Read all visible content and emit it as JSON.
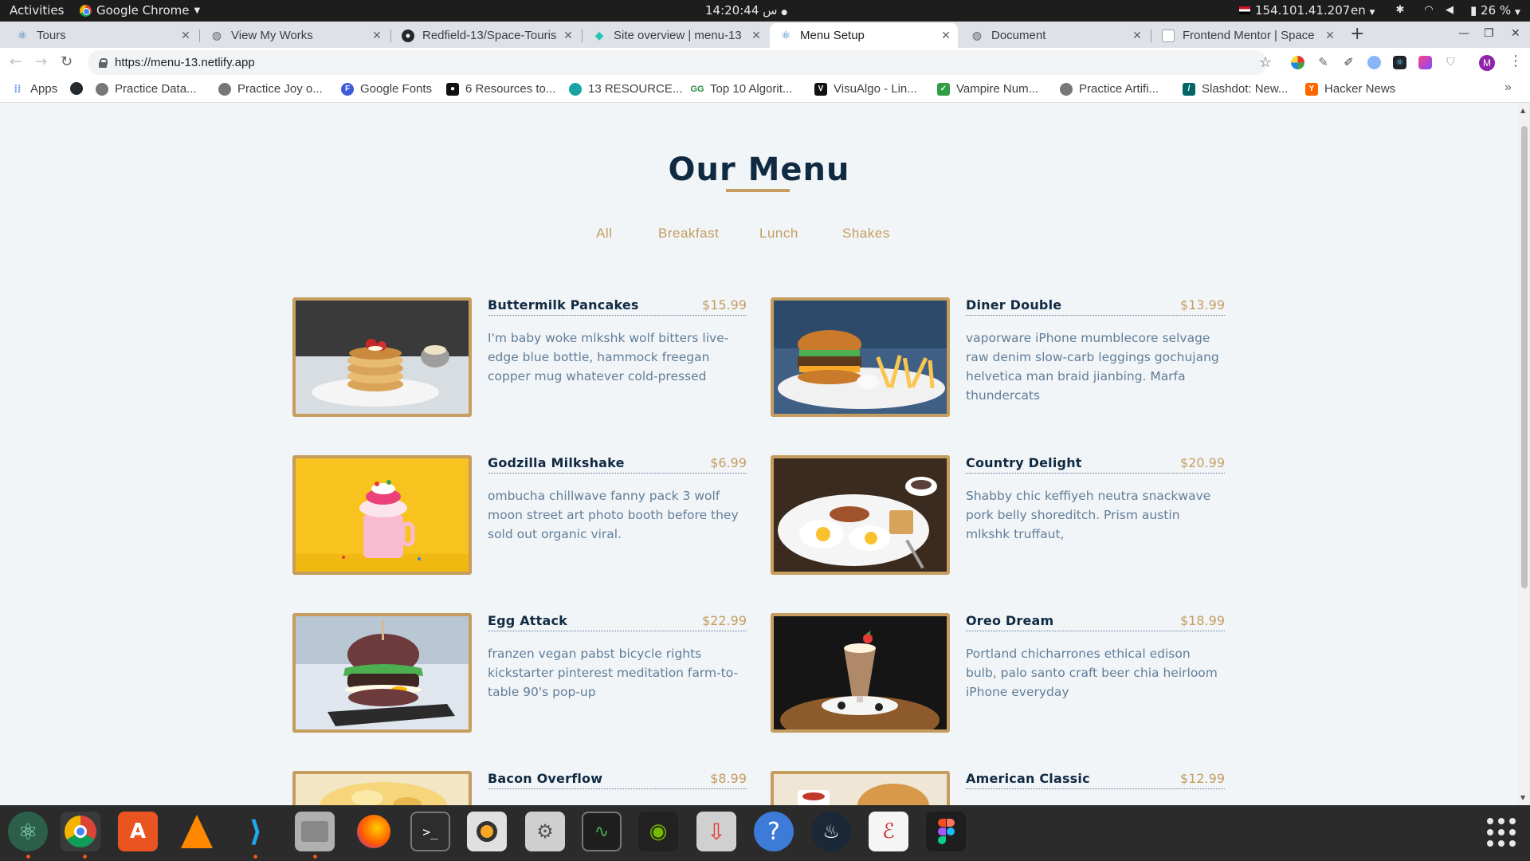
{
  "topbar": {
    "activities": "Activities",
    "app_name": "Google Chrome",
    "clock": "14:20:44 س",
    "ip": "154.101.41.207",
    "lang": "en",
    "battery": "26 %"
  },
  "tabs": [
    {
      "label": "Tours",
      "favicon_color": "#2a7ab0"
    },
    {
      "label": "View My Works",
      "favicon_color": "#5f6368"
    },
    {
      "label": "Redfield-13/Space-Touris",
      "favicon_color": "#24292e"
    },
    {
      "label": "Site overview | menu-13",
      "favicon_color": "#20c6b7"
    },
    {
      "label": "Menu Setup",
      "favicon_color": "#2a7ab0"
    },
    {
      "label": "Document",
      "favicon_color": "#5f6368"
    },
    {
      "label": "Frontend Mentor | Space",
      "favicon_color": "#9aa0a6"
    }
  ],
  "toolbar": {
    "url": "https://menu-13.netlify.app"
  },
  "bookmarks": [
    {
      "label": "Apps",
      "icon": "apps-grid-icon",
      "color": "#4285f4"
    },
    {
      "label": "",
      "icon": "github-icon",
      "color": "#24292e"
    },
    {
      "label": "Practice Data...",
      "icon": "globe-icon",
      "color": "#777777"
    },
    {
      "label": "Practice Joy o...",
      "icon": "globe-icon",
      "color": "#777777"
    },
    {
      "label": "Google Fonts",
      "icon": "fonts-icon",
      "color": "#3b5bdb"
    },
    {
      "label": "6 Resources to...",
      "icon": "medium-icon",
      "color": "#111111"
    },
    {
      "label": "13 RESOURCE...",
      "icon": "globe-icon",
      "color": "#1aa3a3"
    },
    {
      "label": "Top 10 Algorit...",
      "icon": "gfg-icon",
      "color": "#2f8d46"
    },
    {
      "label": "VisuAlgo - Lin...",
      "icon": "visualgo-icon",
      "color": "#111111"
    },
    {
      "label": "Vampire Num...",
      "icon": "bookmark-icon",
      "color": "#2f9e44"
    },
    {
      "label": "Practice Artifi...",
      "icon": "globe-icon",
      "color": "#777777"
    },
    {
      "label": "Slashdot: New...",
      "icon": "slashdot-icon",
      "color": "#006666"
    },
    {
      "label": "Hacker News",
      "icon": "ycombinator-icon",
      "color": "#ff6600"
    }
  ],
  "page": {
    "title": "Our Menu",
    "filters": [
      "All",
      "Breakfast",
      "Lunch",
      "Shakes"
    ],
    "items": [
      {
        "name": "Buttermilk Pancakes",
        "price": "$15.99",
        "desc": "I'm baby woke mlkshk wolf bitters live-edge blue bottle, hammock freegan copper mug whatever cold-pressed"
      },
      {
        "name": "Diner Double",
        "price": "$13.99",
        "desc": "vaporware iPhone mumblecore selvage raw denim slow-carb leggings gochujang helvetica man braid jianbing. Marfa thundercats"
      },
      {
        "name": "Godzilla Milkshake",
        "price": "$6.99",
        "desc": "ombucha chillwave fanny pack 3 wolf moon street art photo booth before they sold out organic viral."
      },
      {
        "name": "Country Delight",
        "price": "$20.99",
        "desc": "Shabby chic keffiyeh neutra snackwave pork belly shoreditch. Prism austin mlkshk truffaut,"
      },
      {
        "name": "Egg Attack",
        "price": "$22.99",
        "desc": "franzen vegan pabst bicycle rights kickstarter pinterest meditation farm-to-table 90's pop-up"
      },
      {
        "name": "Oreo Dream",
        "price": "$18.99",
        "desc": "Portland chicharrones ethical edison bulb, palo santo craft beer chia heirloom iPhone everyday"
      },
      {
        "name": "Bacon Overflow",
        "price": "$8.99",
        "desc": ""
      },
      {
        "name": "American Classic",
        "price": "$12.99",
        "desc": ""
      }
    ]
  },
  "colors": {
    "accent": "#c59d5f",
    "heading": "#102a42",
    "text": "#617d98",
    "background": "#f1f5f8"
  }
}
